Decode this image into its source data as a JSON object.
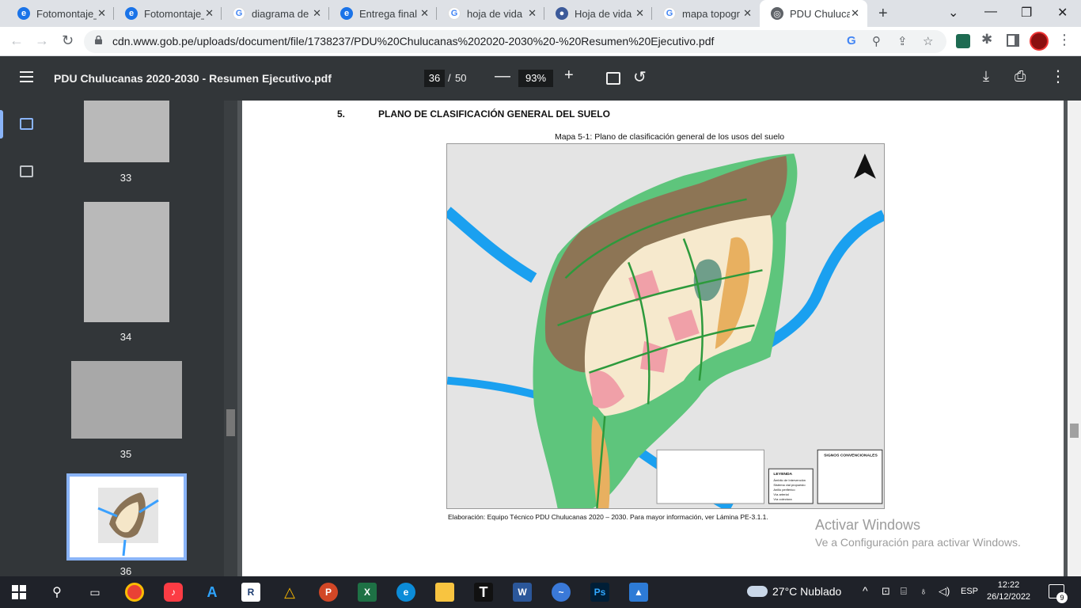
{
  "browser": {
    "tabs": [
      {
        "title": "Fotomontaje_",
        "icon": "chrome-icon"
      },
      {
        "title": "Fotomontaje_",
        "icon": "chrome-icon"
      },
      {
        "title": "diagrama de",
        "icon": "google-icon"
      },
      {
        "title": "Entrega final",
        "icon": "chrome-icon"
      },
      {
        "title": "hoja de vida",
        "icon": "google-icon"
      },
      {
        "title": "Hoja de vida",
        "icon": "user-icon"
      },
      {
        "title": "mapa topogr",
        "icon": "google-icon"
      },
      {
        "title": "PDU Chuluca",
        "icon": "globe-icon"
      }
    ],
    "url": "cdn.www.gob.pe/uploads/document/file/1738237/PDU%20Chulucanas%202020-2030%20-%20Resumen%20Ejecutivo.pdf"
  },
  "pdf": {
    "title": "PDU Chulucanas 2020-2030 - Resumen Ejecutivo.pdf",
    "page_current": "36",
    "page_sep": "/",
    "page_total": "50",
    "zoom": "93%"
  },
  "thumbnails": [
    {
      "label": "33"
    },
    {
      "label": "34"
    },
    {
      "label": "35"
    },
    {
      "label": "36"
    }
  ],
  "page": {
    "section_number": "5.",
    "section_title": "PLANO DE CLASIFICACIÓN GENERAL DEL SUELO",
    "map_caption": "Mapa 5-1: Plano de clasificación general de los usos del suelo",
    "credit": "Elaboración: Equipo Técnico PDU Chulucanas 2020 – 2030. Para mayor información, ver Lámina PE-3.1.1.",
    "legend_title": "LEYENDA",
    "signs_title": "SIGNOS CONVENCIONALES",
    "legend_items": [
      "Ámbito de Intervención",
      "Sistema vial propuesto",
      "Anillo periférico",
      "Vía arterial",
      "Vía colectora"
    ]
  },
  "watermark": {
    "title": "Activar Windows",
    "subtitle": "Ve a Configuración para activar Windows."
  },
  "taskbar": {
    "weather": "27°C  Nublado",
    "lang": "ESP",
    "time": "12:22",
    "date": "26/12/2022",
    "notifications": "9"
  }
}
